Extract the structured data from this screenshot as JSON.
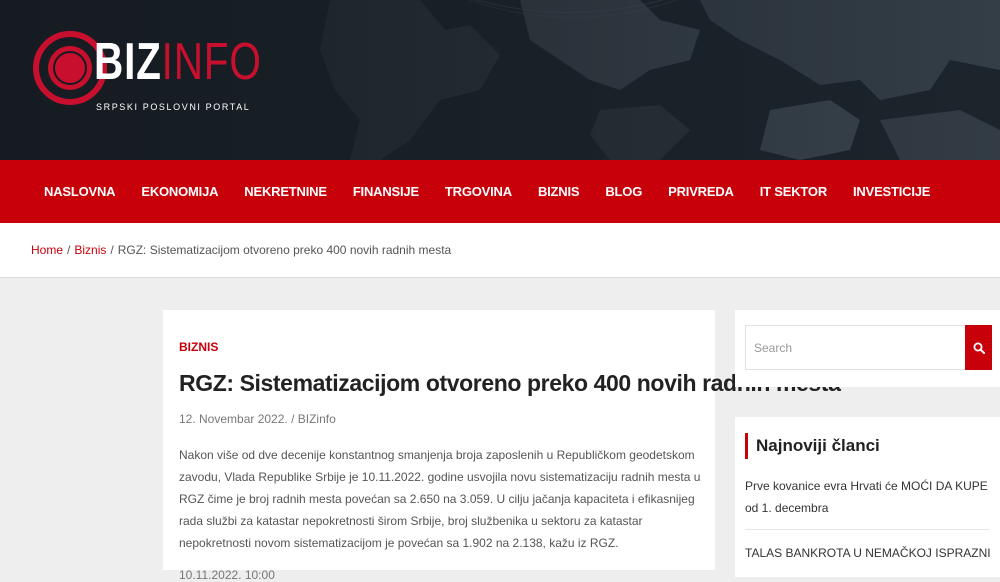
{
  "header": {
    "logo_biz": "BIZ",
    "logo_info": "INFO",
    "tagline": "SRPSKI POSLOVNI PORTAL",
    "logo_icon": "red-ring-icon",
    "colors": {
      "background": "#151b21",
      "accent": "#c8102e"
    }
  },
  "nav": {
    "background": "#c8000a",
    "items": [
      {
        "label": "NASLOVNA"
      },
      {
        "label": "EKONOMIJA"
      },
      {
        "label": "NEKRETNINE"
      },
      {
        "label": "FINANSIJE"
      },
      {
        "label": "TRGOVINA"
      },
      {
        "label": "BIZNIS"
      },
      {
        "label": "BLOG"
      },
      {
        "label": "PRIVREDA"
      },
      {
        "label": "IT SEKTOR"
      },
      {
        "label": "INVESTICIJE"
      }
    ]
  },
  "breadcrumb": {
    "items": [
      {
        "label": "Home"
      },
      {
        "label": "Biznis"
      }
    ],
    "current": "RGZ: Sistematizacijom otvoreno preko 400 novih radnih mesta",
    "separator": "/"
  },
  "article": {
    "category": "BIZNIS",
    "title": "RGZ: Sistematizacijom otvoreno preko 400 novih radnih mesta",
    "meta": "12. Novembar 2022. / BIZinfo",
    "body": "Nakon više od dve decenije konstantnog smanjenja broja zaposlenih u Republičkom geodetskom zavodu, Vlada Republike Srbije je 10.11.2022. godine usvojila novu sistematizaciju radnih mesta u RGZ čime je broj radnih mesta povećan sa 2.650 na 3.059. U cilju jačanja kapaciteta i efikasnijeg rada službi za katastar nepokretnosti širom Srbije, broj službenika u sektoru za katastar nepokretnosti novom sistematizacijom je povećan sa 1.902 na 2.138, kažu iz RGZ.",
    "date_line": "10.11.2022. 10:00"
  },
  "sidebar": {
    "search": {
      "placeholder": "Search",
      "icon": "search-icon"
    },
    "recent": {
      "title": "Najnoviji članci",
      "items": [
        {
          "label": "Prve kovanice evra Hrvati će MOĆI DA KUPE od 1. decembra"
        },
        {
          "label": "TALAS BANKROTA U NEMAČKOJ ISPRAZNIO GRADSKA"
        }
      ]
    }
  }
}
